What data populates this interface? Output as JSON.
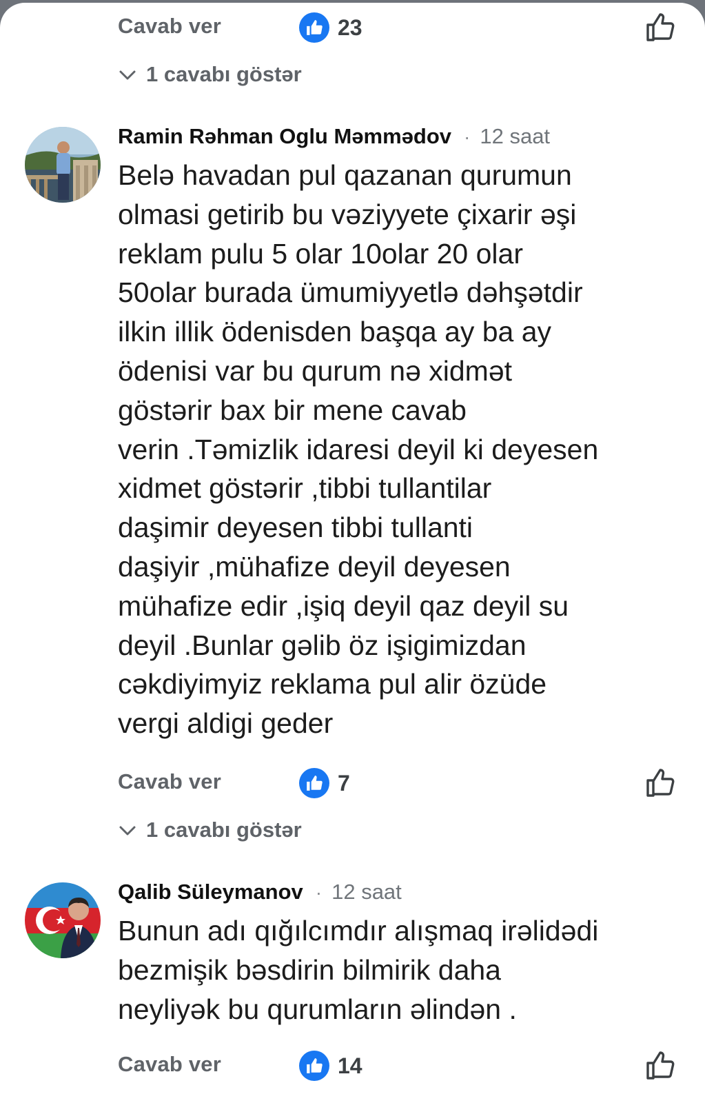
{
  "thread": {
    "top_actions": {
      "reply_label": "Cavab ver",
      "like_count": "23",
      "show_replies_label": "1 cavabı göstər"
    },
    "comments": [
      {
        "author": "Ramin Rəhman Oglu Məmmədov",
        "separator": "·",
        "time": "12 saat",
        "text": "Belə havadan pul qazanan qurumun\nolmasi getirib bu vəziyyete çixarir əşi\nreklam pulu 5 olar 10olar 20 olar\n50olar burada ümumiyyetlə dəhşətdir\nilkin illik ödenisden başqa ay ba ay\nödenisi var bu qurum nə xidmət\ngöstərir bax bir mene cavab\nverin .Təmizlik idaresi deyil ki deyesen\nxidmet göstərir ,tibbi tullantilar\ndaşimir deyesen tibbi tullanti\ndaşiyir ,mühafize deyil deyesen\nmühafize edir ,işiq deyil qaz deyil su\ndeyil .Bunlar gəlib öz işigimizdan\ncəkdiyimyiz reklama pul alir özüde\nvergi aldigi geder",
        "reply_label": "Cavab ver",
        "like_count": "7",
        "show_replies_label": "1 cavabı göstər"
      },
      {
        "author": "Qalib Süleymanov",
        "separator": "·",
        "time": "12 saat",
        "text": "Bunun adı qığılcımdır alışmaq irəlidədi\nbezmişik bəsdirin bilmirik daha\nneyliyək bu qurumların əlindən .",
        "reply_label": "Cavab ver",
        "like_count": "14"
      }
    ]
  },
  "colors": {
    "like_blue": "#1877f2",
    "secondary_text": "#5f6368",
    "body_text": "#1c1c1c"
  },
  "icons": [
    "like-reaction-icon",
    "thumbs-up-outline-icon",
    "chevron-down-icon"
  ]
}
